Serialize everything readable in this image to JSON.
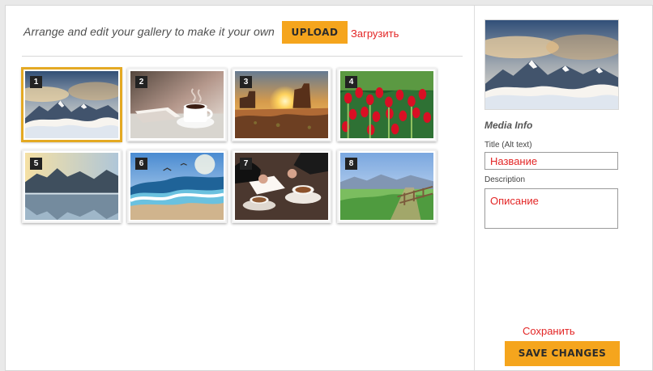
{
  "toolbar": {
    "instruction": "Arrange and edit your gallery to make it your own",
    "upload_label": "UPLOAD",
    "upload_note": "Загрузить",
    "accent": "#f5a51d",
    "note_color": "#e32525"
  },
  "gallery": {
    "selected": 1,
    "items": [
      {
        "number": "1",
        "image": "mountains-clouds"
      },
      {
        "number": "2",
        "image": "coffee-cup"
      },
      {
        "number": "3",
        "image": "desert-sunset"
      },
      {
        "number": "4",
        "image": "red-tulips"
      },
      {
        "number": "5",
        "image": "mountain-lake"
      },
      {
        "number": "6",
        "image": "beach-waves"
      },
      {
        "number": "7",
        "image": "coffee-table"
      },
      {
        "number": "8",
        "image": "grass-field"
      }
    ]
  },
  "media_info": {
    "preview_image": "mountains-clouds",
    "heading": "Media Info",
    "title_label": "Title (Alt text)",
    "title_value": "",
    "title_placeholder": "Название",
    "description_label": "Description",
    "description_value": "",
    "description_placeholder": "Описание"
  },
  "actions": {
    "save_note": "Сохранить",
    "save_label": "SAVE CHANGES"
  }
}
